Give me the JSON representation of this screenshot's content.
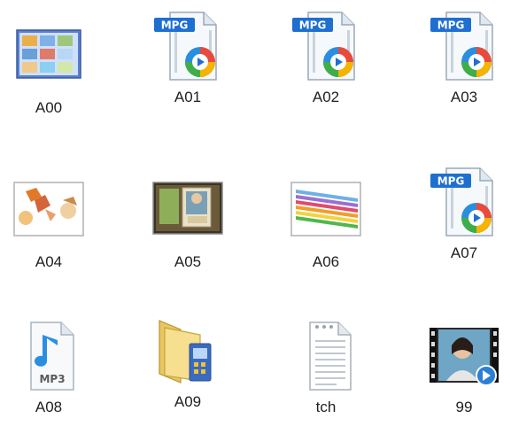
{
  "files": [
    {
      "name": "A00",
      "icon": "image-gallery-thumbnail-icon"
    },
    {
      "name": "A01",
      "icon": "mpg-video-file-icon"
    },
    {
      "name": "A02",
      "icon": "mpg-video-file-icon"
    },
    {
      "name": "A03",
      "icon": "mpg-video-file-icon"
    },
    {
      "name": "A04",
      "icon": "image-thumbnail-icon"
    },
    {
      "name": "A05",
      "icon": "image-thumbnail-icon"
    },
    {
      "name": "A06",
      "icon": "image-thumbnail-icon"
    },
    {
      "name": "A07",
      "icon": "mpg-video-file-icon"
    },
    {
      "name": "A08",
      "icon": "mp3-audio-file-icon"
    },
    {
      "name": "A09",
      "icon": "folder-icon"
    },
    {
      "name": "tch",
      "icon": "text-document-icon"
    },
    {
      "name": "99",
      "icon": "video-thumbnail-icon"
    }
  ],
  "mpg_badge": "MPG",
  "mp3_badge": "MP3"
}
